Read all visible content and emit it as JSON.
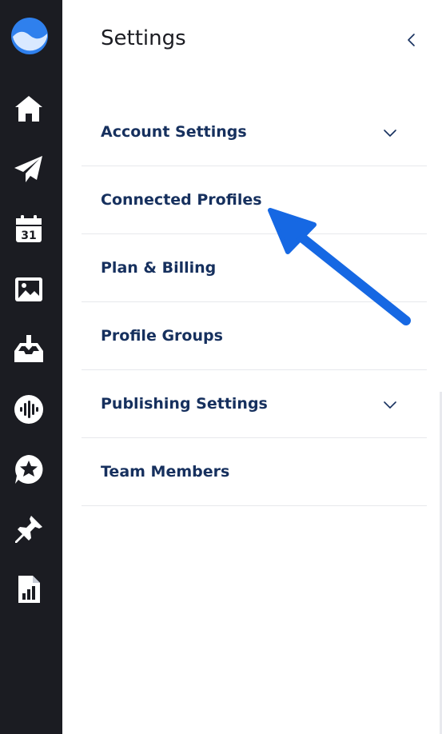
{
  "sidebar": {
    "logo_icon": "brand-wave-logo",
    "items": [
      {
        "icon": "home-icon"
      },
      {
        "icon": "paper-plane-icon"
      },
      {
        "icon": "calendar-icon",
        "day": "31"
      },
      {
        "icon": "image-icon"
      },
      {
        "icon": "inbox-download-icon"
      },
      {
        "icon": "audio-wave-icon"
      },
      {
        "icon": "star-badge-icon"
      },
      {
        "icon": "pin-icon"
      },
      {
        "icon": "report-chart-icon"
      }
    ]
  },
  "settings": {
    "title": "Settings",
    "collapse_icon": "chevron-left-icon",
    "menu": [
      {
        "label": "Account Settings",
        "expandable": true
      },
      {
        "label": "Connected Profiles",
        "expandable": false
      },
      {
        "label": "Plan & Billing",
        "expandable": false
      },
      {
        "label": "Profile Groups",
        "expandable": false
      },
      {
        "label": "Publishing Settings",
        "expandable": true
      },
      {
        "label": "Team Members",
        "expandable": false
      }
    ]
  },
  "colors": {
    "rail_bg": "#1b1c22",
    "menu_text": "#16305e",
    "accent_arrow": "#1668e3",
    "logo_blue": "#2f80ed"
  }
}
